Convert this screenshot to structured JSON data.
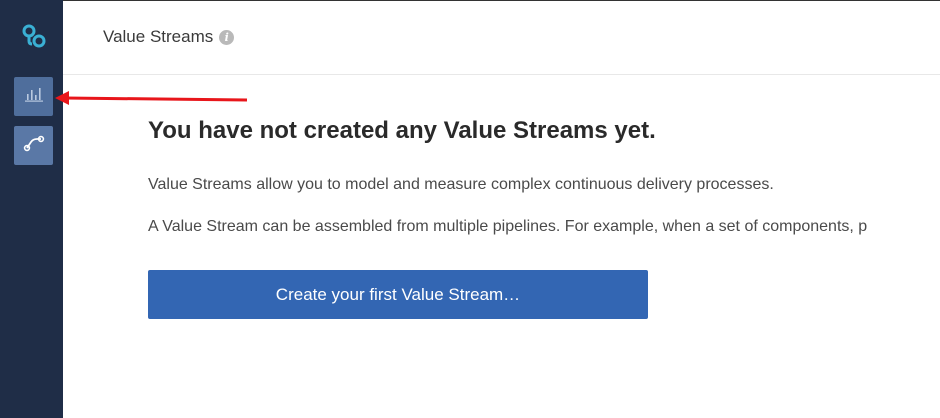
{
  "header": {
    "title": "Value Streams",
    "info_icon": "info-icon"
  },
  "sidebar": {
    "logo_icon": "logo-icon",
    "items": [
      {
        "icon": "bar-chart-icon",
        "active": true
      },
      {
        "icon": "pipeline-icon",
        "active": false
      }
    ]
  },
  "empty_state": {
    "headline": "You have not created any Value Streams yet.",
    "description_1": "Value Streams allow you to model and measure complex continuous delivery processes.",
    "description_2": "A Value Stream can be assembled from multiple pipelines. For example, when a set of components, p",
    "cta_label": "Create your first Value Stream…"
  },
  "annotation": {
    "arrow_color": "#e8161b"
  },
  "colors": {
    "sidebar_bg": "#1f2d47",
    "nav_button_bg": "#5a78a6",
    "primary_button": "#3366b3",
    "logo": "#3ab0d4"
  }
}
